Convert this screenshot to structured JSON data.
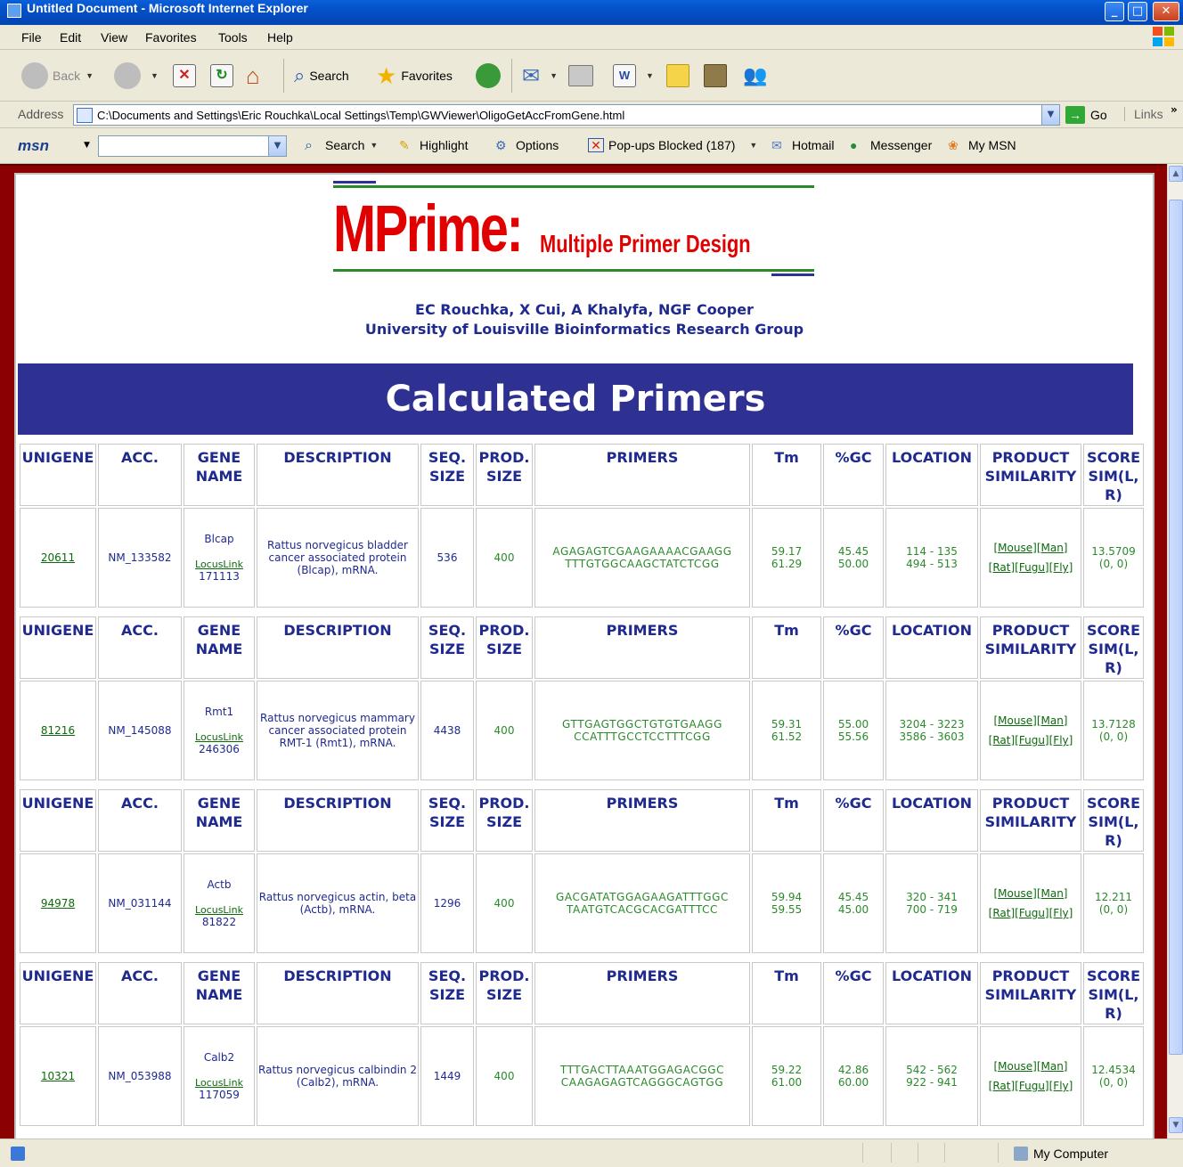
{
  "window": {
    "title": "Untitled Document - Microsoft Internet Explorer"
  },
  "menu": [
    "File",
    "Edit",
    "View",
    "Favorites",
    "Tools",
    "Help"
  ],
  "toolbar": {
    "back": "Back",
    "search": "Search",
    "favorites": "Favorites"
  },
  "address": {
    "label": "Address",
    "url": "C:\\Documents and Settings\\Eric Rouchka\\Local Settings\\Temp\\GWViewer\\OligoGetAccFromGene.html",
    "go": "Go",
    "links": "Links"
  },
  "msn": {
    "logo": "msn",
    "search": "Search",
    "highlight": "Highlight",
    "options": "Options",
    "popups": "Pop-ups Blocked (187)",
    "hotmail": "Hotmail",
    "messenger": "Messenger",
    "mymsn": "My MSN"
  },
  "status": {
    "zone": "My Computer"
  },
  "page": {
    "logo_big": "MPrime:",
    "logo_small": "Multiple Primer Design",
    "authors": "EC Rouchka, X Cui, A Khalyfa, NGF Cooper",
    "group": "University of Louisville Bioinformatics Research Group",
    "banner": "Calculated Primers"
  },
  "headers": {
    "unigene": "UNIGENE",
    "acc": "ACC.",
    "gene_name": "GENE NAME",
    "description": "DESCRIPTION",
    "seq_size": "SEQ. SIZE",
    "prod_size": "PROD. SIZE",
    "primers": "PRIMERS",
    "tm": "Tm",
    "gc": "%GC",
    "location": "LOCATION",
    "product_similarity": "PRODUCT SIMILARITY",
    "score": "SCORE SIM(L, R)"
  },
  "sim_links": {
    "mouse": "[Mouse]",
    "man": "[Man]",
    "rat": "[Rat]",
    "fugu": "[Fugu]",
    "fly": "[Fly]"
  },
  "rows": [
    {
      "unigene": "20611",
      "acc": "NM_133582",
      "gene": "Blcap",
      "locuslink": "LocusLink",
      "locusid": "171113",
      "description": "Rattus norvegicus bladder cancer associated protein (Blcap), mRNA.",
      "seq_size": "536",
      "prod_size": "400",
      "primer_l": "AGAGAGTCGAAGAAAACGAAGG",
      "primer_r": "TTTGTGGCAAGCTATCTCGG",
      "tm_l": "59.17",
      "tm_r": "61.29",
      "gc_l": "45.45",
      "gc_r": "50.00",
      "loc_l": "114 - 135",
      "loc_r": "494 - 513",
      "score": "13.5709",
      "sim": "(0, 0)"
    },
    {
      "unigene": "81216",
      "acc": "NM_145088",
      "gene": "Rmt1",
      "locuslink": "LocusLink",
      "locusid": "246306",
      "description": "Rattus norvegicus mammary cancer associated protein RMT-1 (Rmt1), mRNA.",
      "seq_size": "4438",
      "prod_size": "400",
      "primer_l": "GTTGAGTGGCTGTGTGAAGG",
      "primer_r": "CCATTTGCCTCCTTTCGG",
      "tm_l": "59.31",
      "tm_r": "61.52",
      "gc_l": "55.00",
      "gc_r": "55.56",
      "loc_l": "3204 - 3223",
      "loc_r": "3586 - 3603",
      "score": "13.7128",
      "sim": "(0, 0)"
    },
    {
      "unigene": "94978",
      "acc": "NM_031144",
      "gene": "Actb",
      "locuslink": "LocusLink",
      "locusid": "81822",
      "description": "Rattus norvegicus actin, beta (Actb), mRNA.",
      "seq_size": "1296",
      "prod_size": "400",
      "primer_l": "GACGATATGGAGAAGATTTGGC",
      "primer_r": "TAATGTCACGCACGATTTCC",
      "tm_l": "59.94",
      "tm_r": "59.55",
      "gc_l": "45.45",
      "gc_r": "45.00",
      "loc_l": "320 - 341",
      "loc_r": "700 - 719",
      "score": "12.211",
      "sim": "(0, 0)"
    },
    {
      "unigene": "10321",
      "acc": "NM_053988",
      "gene": "Calb2",
      "locuslink": "LocusLink",
      "locusid": "117059",
      "description": "Rattus norvegicus calbindin 2 (Calb2), mRNA.",
      "seq_size": "1449",
      "prod_size": "400",
      "primer_l": "TTTGACTTAAATGGAGACGGC",
      "primer_r": "CAAGAGAGTCAGGGCAGTGG",
      "tm_l": "59.22",
      "tm_r": "61.00",
      "gc_l": "42.86",
      "gc_r": "60.00",
      "loc_l": "542 - 562",
      "loc_r": "922 - 941",
      "score": "12.4534",
      "sim": "(0, 0)"
    }
  ]
}
